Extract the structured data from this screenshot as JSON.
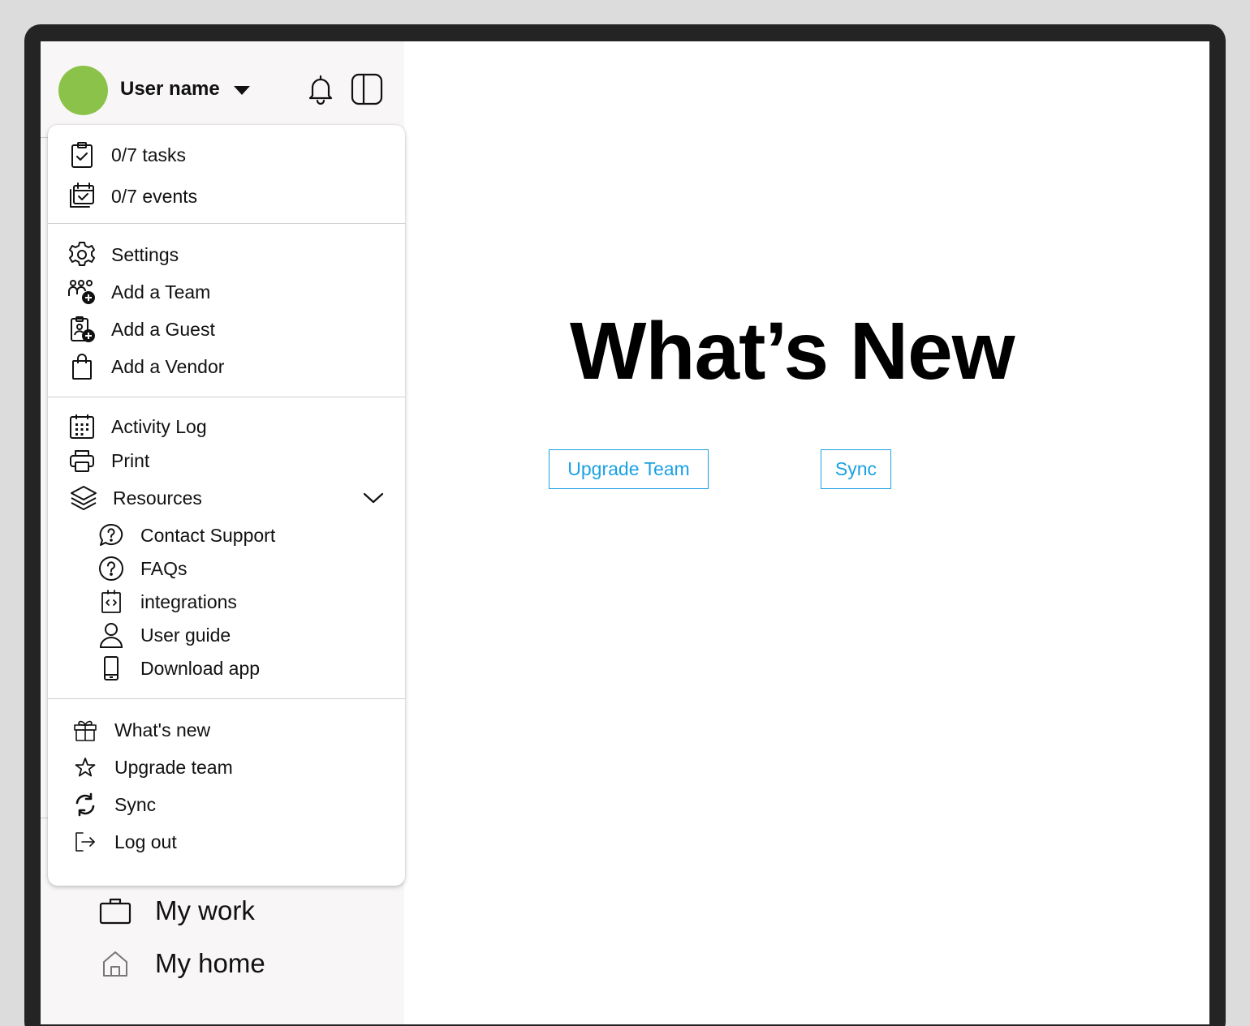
{
  "user": {
    "name": "User name",
    "avatar_color": "#8bc34a"
  },
  "header_icons": [
    "bell-icon",
    "sidebar-toggle-icon"
  ],
  "sidebar_nav": [
    {
      "label": "My work",
      "icon": "briefcase-icon"
    },
    {
      "label": "My home",
      "icon": "home-icon"
    }
  ],
  "menu": {
    "summary": [
      {
        "label": "0/7 tasks",
        "icon": "clipboard-check-icon"
      },
      {
        "label": "0/7 events",
        "icon": "calendar-check-icon"
      }
    ],
    "manage": [
      {
        "label": "Settings",
        "icon": "gear-icon"
      },
      {
        "label": "Add a Team",
        "icon": "add-team-icon"
      },
      {
        "label": "Add a Guest",
        "icon": "add-guest-icon"
      },
      {
        "label": "Add a Vendor",
        "icon": "shopping-bag-icon"
      }
    ],
    "tools": [
      {
        "label": "Activity Log",
        "icon": "calendar-grid-icon"
      },
      {
        "label": "Print",
        "icon": "printer-icon"
      },
      {
        "label": "Resources",
        "icon": "layers-icon",
        "expanded": true
      }
    ],
    "resources": [
      {
        "label": "Contact Support",
        "icon": "support-bubble-icon"
      },
      {
        "label": "FAQs",
        "icon": "question-circle-icon"
      },
      {
        "label": "integrations",
        "icon": "code-icon"
      },
      {
        "label": "User guide",
        "icon": "user-icon"
      },
      {
        "label": "Download app",
        "icon": "phone-icon"
      }
    ],
    "account": [
      {
        "label": "What's new",
        "icon": "gift-icon"
      },
      {
        "label": "Upgrade team",
        "icon": "star-icon"
      },
      {
        "label": "Sync",
        "icon": "sync-icon"
      },
      {
        "label": "Log out",
        "icon": "logout-icon"
      }
    ]
  },
  "main": {
    "title": "What’s New",
    "upgrade_button": "Upgrade Team",
    "sync_button": "Sync",
    "accent_color": "#1ba1e2"
  }
}
